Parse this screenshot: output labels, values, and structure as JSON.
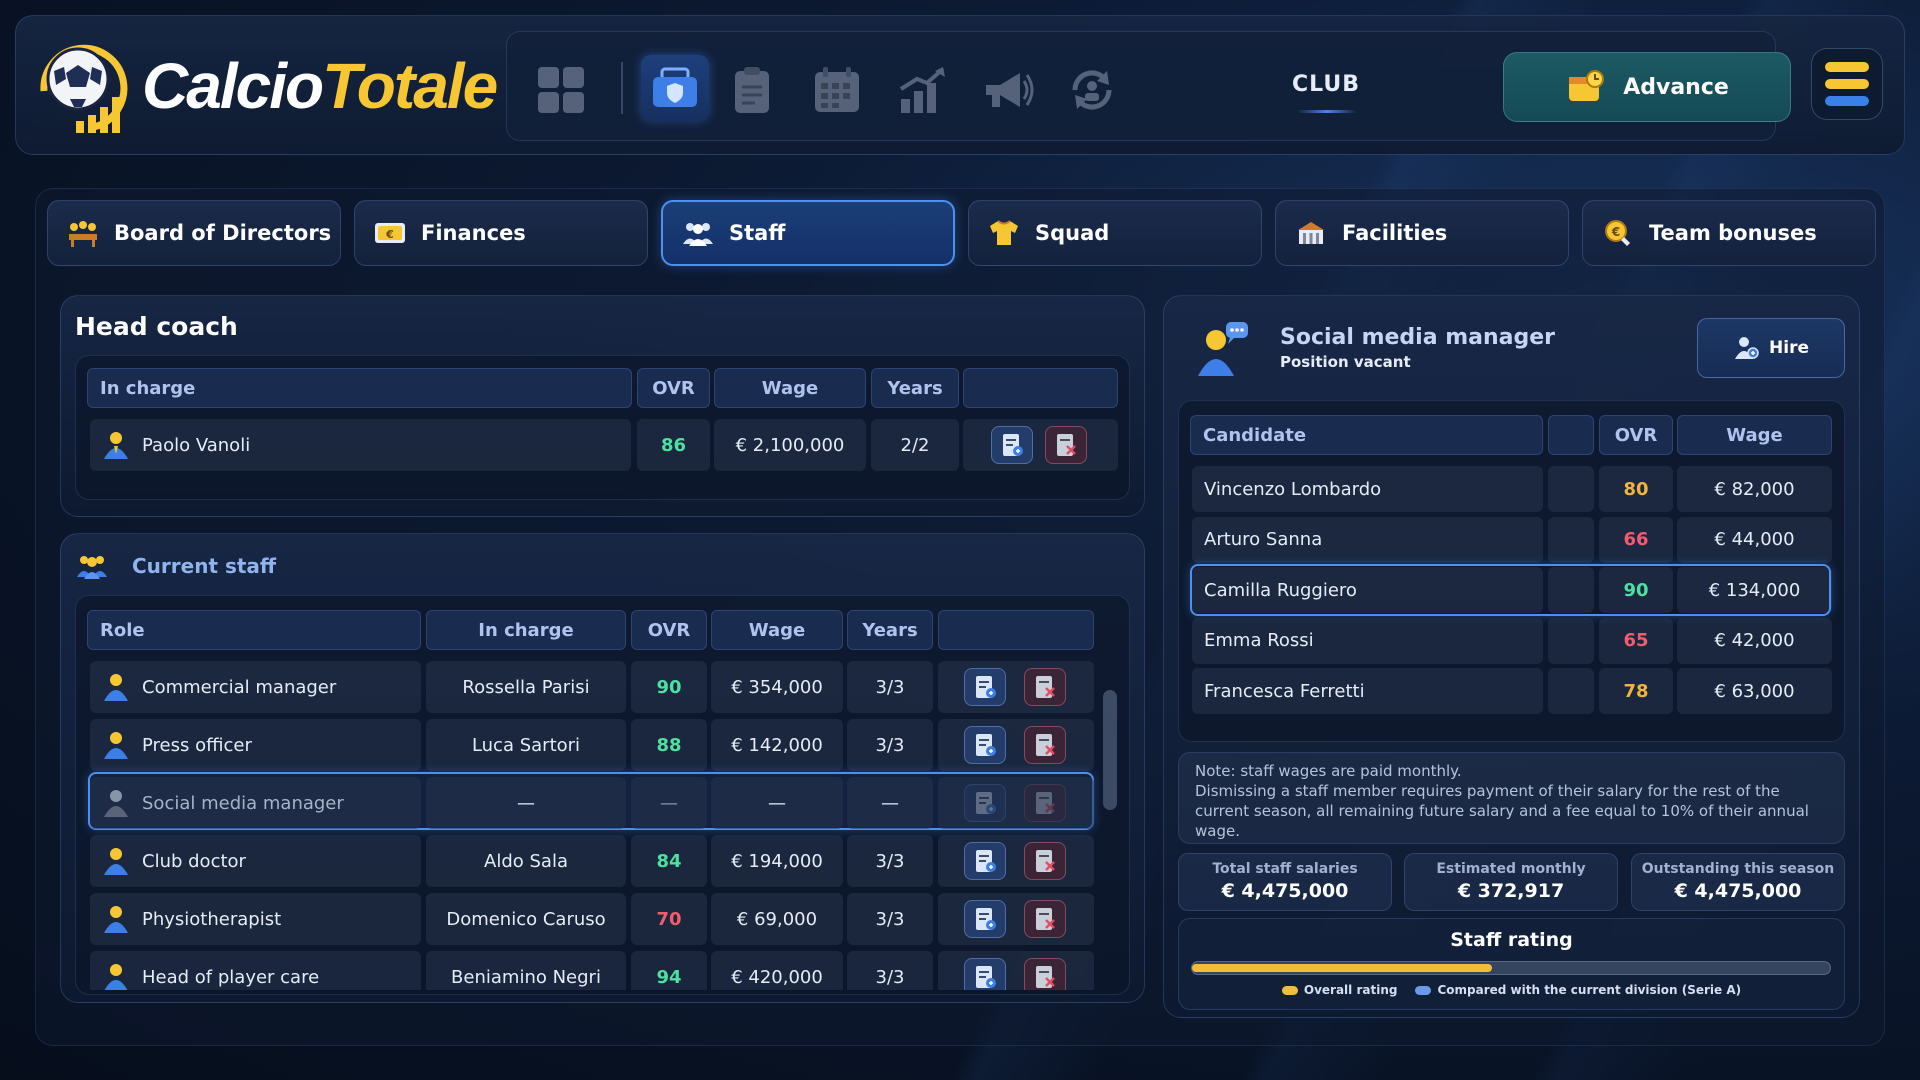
{
  "app": {
    "logo_word_1": "Calcio",
    "logo_word_2": "Totale"
  },
  "topbar": {
    "nav_icons": [
      "dashboard-icon",
      "club-briefcase-icon",
      "tactics-clipboard-icon",
      "calendar-icon",
      "stats-chart-icon",
      "news-megaphone-icon",
      "transfers-icon"
    ],
    "active_nav": "club-briefcase-icon",
    "section_label": "CLUB",
    "advance_label": "Advance"
  },
  "tabs": [
    {
      "label": "Board of Directors",
      "icon": "board-icon"
    },
    {
      "label": "Finances",
      "icon": "finances-icon"
    },
    {
      "label": "Staff",
      "icon": "staff-icon",
      "active": true
    },
    {
      "label": "Squad",
      "icon": "squad-shirt-icon"
    },
    {
      "label": "Facilities",
      "icon": "stadium-icon"
    },
    {
      "label": "Team bonuses",
      "icon": "bonus-icon"
    }
  ],
  "head_coach": {
    "title": "Head coach",
    "headers": {
      "in_charge": "In charge",
      "ovr": "OVR",
      "wage": "Wage",
      "years": "Years"
    },
    "row": {
      "name": "Paolo Vanoli",
      "ovr": "86",
      "wage": "€ 2,100,000",
      "years": "2/2"
    }
  },
  "current_staff": {
    "title": "Current staff",
    "headers": {
      "role": "Role",
      "in_charge": "In charge",
      "ovr": "OVR",
      "wage": "Wage",
      "years": "Years"
    },
    "rows": [
      {
        "role": "Commercial manager",
        "in_charge": "Rossella Parisi",
        "ovr": "90",
        "wage": "€ 354,000",
        "years": "3/3"
      },
      {
        "role": "Press officer",
        "in_charge": "Luca Sartori",
        "ovr": "88",
        "wage": "€ 142,000",
        "years": "3/3"
      },
      {
        "role": "Social media manager",
        "in_charge": "—",
        "ovr": "—",
        "wage": "—",
        "years": "—"
      },
      {
        "role": "Club doctor",
        "in_charge": "Aldo Sala",
        "ovr": "84",
        "wage": "€ 194,000",
        "years": "3/3"
      },
      {
        "role": "Physiotherapist",
        "in_charge": "Domenico Caruso",
        "ovr": "70",
        "wage": "€ 69,000",
        "years": "3/3"
      },
      {
        "role": "Head of player care",
        "in_charge": "Beniamino Negri",
        "ovr": "94",
        "wage": "€ 420,000",
        "years": "3/3"
      }
    ]
  },
  "vacancy": {
    "title": "Social media manager",
    "subtitle": "Position vacant",
    "hire_label": "Hire",
    "headers": {
      "candidate": "Candidate",
      "ovr": "OVR",
      "wage": "Wage"
    },
    "candidates": [
      {
        "name": "Vincenzo Lombardo",
        "ovr": "80",
        "wage": "€ 82,000"
      },
      {
        "name": "Arturo Sanna",
        "ovr": "66",
        "wage": "€ 44,000"
      },
      {
        "name": "Camilla Ruggiero",
        "ovr": "90",
        "wage": "€ 134,000"
      },
      {
        "name": "Emma Rossi",
        "ovr": "65",
        "wage": "€ 42,000"
      },
      {
        "name": "Francesca Ferretti",
        "ovr": "78",
        "wage": "€ 63,000"
      }
    ]
  },
  "note": {
    "line1": "Note: staff wages are paid monthly.",
    "line2": "Dismissing a staff member requires payment of their salary for the rest of the current season, all remaining future salary and a fee equal to 10% of their annual wage."
  },
  "stats": [
    {
      "label": "Total staff salaries",
      "value": "€ 4,475,000"
    },
    {
      "label": "Estimated monthly",
      "value": "€ 372,917"
    },
    {
      "label": "Outstanding this season",
      "value": "€ 4,475,000"
    }
  ],
  "staff_rating": {
    "title": "Staff rating",
    "overall_fraction": 0.47,
    "compare_fraction": 0.0,
    "legend_overall": "Overall rating",
    "legend_compare": "Compared with the current division (Serie A)"
  },
  "colors": {
    "accent_blue": "#4d90f2",
    "ovr_high": "#4de0a0",
    "ovr_mid": "#f2b33c",
    "ovr_low": "#f25c6e",
    "gold": "#f6c633"
  }
}
